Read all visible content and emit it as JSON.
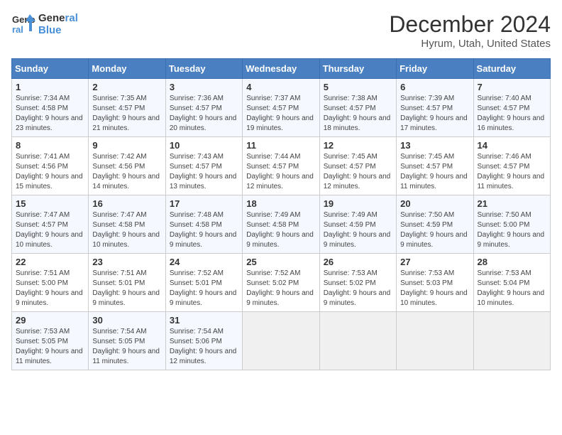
{
  "logo": {
    "line1": "General",
    "line2": "Blue"
  },
  "title": "December 2024",
  "location": "Hyrum, Utah, United States",
  "days_of_week": [
    "Sunday",
    "Monday",
    "Tuesday",
    "Wednesday",
    "Thursday",
    "Friday",
    "Saturday"
  ],
  "weeks": [
    [
      {
        "day": "1",
        "sunrise": "7:34 AM",
        "sunset": "4:58 PM",
        "daylight": "9 hours and 23 minutes."
      },
      {
        "day": "2",
        "sunrise": "7:35 AM",
        "sunset": "4:57 PM",
        "daylight": "9 hours and 21 minutes."
      },
      {
        "day": "3",
        "sunrise": "7:36 AM",
        "sunset": "4:57 PM",
        "daylight": "9 hours and 20 minutes."
      },
      {
        "day": "4",
        "sunrise": "7:37 AM",
        "sunset": "4:57 PM",
        "daylight": "9 hours and 19 minutes."
      },
      {
        "day": "5",
        "sunrise": "7:38 AM",
        "sunset": "4:57 PM",
        "daylight": "9 hours and 18 minutes."
      },
      {
        "day": "6",
        "sunrise": "7:39 AM",
        "sunset": "4:57 PM",
        "daylight": "9 hours and 17 minutes."
      },
      {
        "day": "7",
        "sunrise": "7:40 AM",
        "sunset": "4:57 PM",
        "daylight": "9 hours and 16 minutes."
      }
    ],
    [
      {
        "day": "8",
        "sunrise": "7:41 AM",
        "sunset": "4:56 PM",
        "daylight": "9 hours and 15 minutes."
      },
      {
        "day": "9",
        "sunrise": "7:42 AM",
        "sunset": "4:56 PM",
        "daylight": "9 hours and 14 minutes."
      },
      {
        "day": "10",
        "sunrise": "7:43 AM",
        "sunset": "4:57 PM",
        "daylight": "9 hours and 13 minutes."
      },
      {
        "day": "11",
        "sunrise": "7:44 AM",
        "sunset": "4:57 PM",
        "daylight": "9 hours and 12 minutes."
      },
      {
        "day": "12",
        "sunrise": "7:45 AM",
        "sunset": "4:57 PM",
        "daylight": "9 hours and 12 minutes."
      },
      {
        "day": "13",
        "sunrise": "7:45 AM",
        "sunset": "4:57 PM",
        "daylight": "9 hours and 11 minutes."
      },
      {
        "day": "14",
        "sunrise": "7:46 AM",
        "sunset": "4:57 PM",
        "daylight": "9 hours and 11 minutes."
      }
    ],
    [
      {
        "day": "15",
        "sunrise": "7:47 AM",
        "sunset": "4:57 PM",
        "daylight": "9 hours and 10 minutes."
      },
      {
        "day": "16",
        "sunrise": "7:47 AM",
        "sunset": "4:58 PM",
        "daylight": "9 hours and 10 minutes."
      },
      {
        "day": "17",
        "sunrise": "7:48 AM",
        "sunset": "4:58 PM",
        "daylight": "9 hours and 9 minutes."
      },
      {
        "day": "18",
        "sunrise": "7:49 AM",
        "sunset": "4:58 PM",
        "daylight": "9 hours and 9 minutes."
      },
      {
        "day": "19",
        "sunrise": "7:49 AM",
        "sunset": "4:59 PM",
        "daylight": "9 hours and 9 minutes."
      },
      {
        "day": "20",
        "sunrise": "7:50 AM",
        "sunset": "4:59 PM",
        "daylight": "9 hours and 9 minutes."
      },
      {
        "day": "21",
        "sunrise": "7:50 AM",
        "sunset": "5:00 PM",
        "daylight": "9 hours and 9 minutes."
      }
    ],
    [
      {
        "day": "22",
        "sunrise": "7:51 AM",
        "sunset": "5:00 PM",
        "daylight": "9 hours and 9 minutes."
      },
      {
        "day": "23",
        "sunrise": "7:51 AM",
        "sunset": "5:01 PM",
        "daylight": "9 hours and 9 minutes."
      },
      {
        "day": "24",
        "sunrise": "7:52 AM",
        "sunset": "5:01 PM",
        "daylight": "9 hours and 9 minutes."
      },
      {
        "day": "25",
        "sunrise": "7:52 AM",
        "sunset": "5:02 PM",
        "daylight": "9 hours and 9 minutes."
      },
      {
        "day": "26",
        "sunrise": "7:53 AM",
        "sunset": "5:02 PM",
        "daylight": "9 hours and 9 minutes."
      },
      {
        "day": "27",
        "sunrise": "7:53 AM",
        "sunset": "5:03 PM",
        "daylight": "9 hours and 10 minutes."
      },
      {
        "day": "28",
        "sunrise": "7:53 AM",
        "sunset": "5:04 PM",
        "daylight": "9 hours and 10 minutes."
      }
    ],
    [
      {
        "day": "29",
        "sunrise": "7:53 AM",
        "sunset": "5:05 PM",
        "daylight": "9 hours and 11 minutes."
      },
      {
        "day": "30",
        "sunrise": "7:54 AM",
        "sunset": "5:05 PM",
        "daylight": "9 hours and 11 minutes."
      },
      {
        "day": "31",
        "sunrise": "7:54 AM",
        "sunset": "5:06 PM",
        "daylight": "9 hours and 12 minutes."
      },
      null,
      null,
      null,
      null
    ]
  ],
  "labels": {
    "sunrise": "Sunrise:",
    "sunset": "Sunset:",
    "daylight": "Daylight:"
  }
}
